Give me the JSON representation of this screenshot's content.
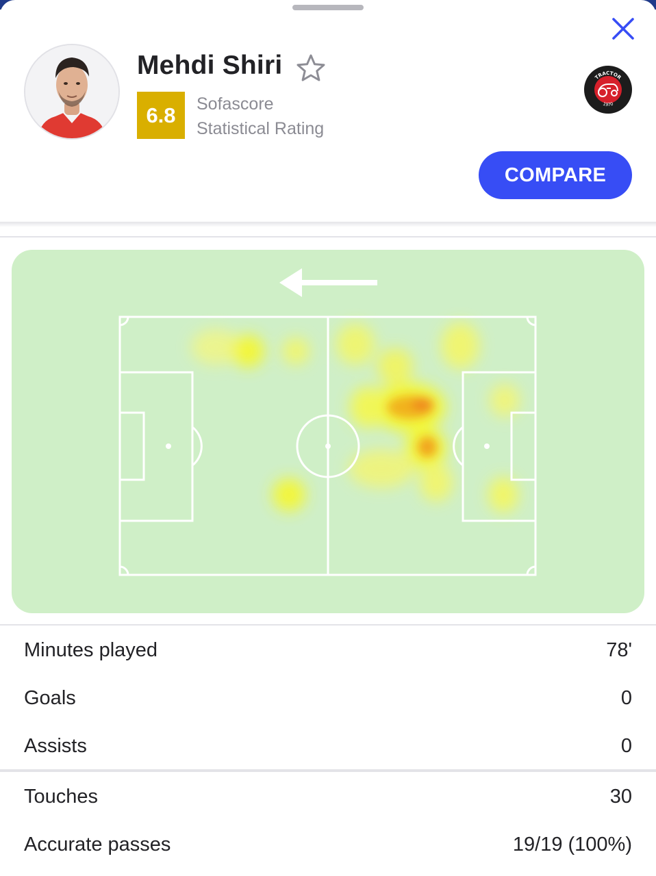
{
  "player": {
    "name": "Mehdi Shiri",
    "rating": "6.8",
    "rating_label_line1": "Sofascore",
    "rating_label_line2": "Statistical Rating",
    "team_logo": {
      "top_text": "TRACTOR",
      "bottom_text": "1970",
      "colors": {
        "outer": "#1c1c1c",
        "inner": "#d6202b"
      }
    }
  },
  "actions": {
    "compare_label": "COMPARE"
  },
  "icons": {
    "close": "close-icon",
    "favorite": "star-icon",
    "direction": "arrow-left-icon"
  },
  "colors": {
    "accent": "#374df5",
    "rating_bg": "#d9af00",
    "pitch_bg": "#cfefc7",
    "pitch_lines": "#ffffff",
    "heat_low": "#f6f72e",
    "heat_high": "#f08a1a"
  },
  "heatmap": {
    "attack_direction": "left"
  },
  "stats_group1": [
    {
      "label": "Minutes played",
      "value": "78'"
    },
    {
      "label": "Goals",
      "value": "0"
    },
    {
      "label": "Assists",
      "value": "0"
    }
  ],
  "stats_group2": [
    {
      "label": "Touches",
      "value": "30"
    },
    {
      "label": "Accurate passes",
      "value": "19/19 (100%)"
    }
  ]
}
